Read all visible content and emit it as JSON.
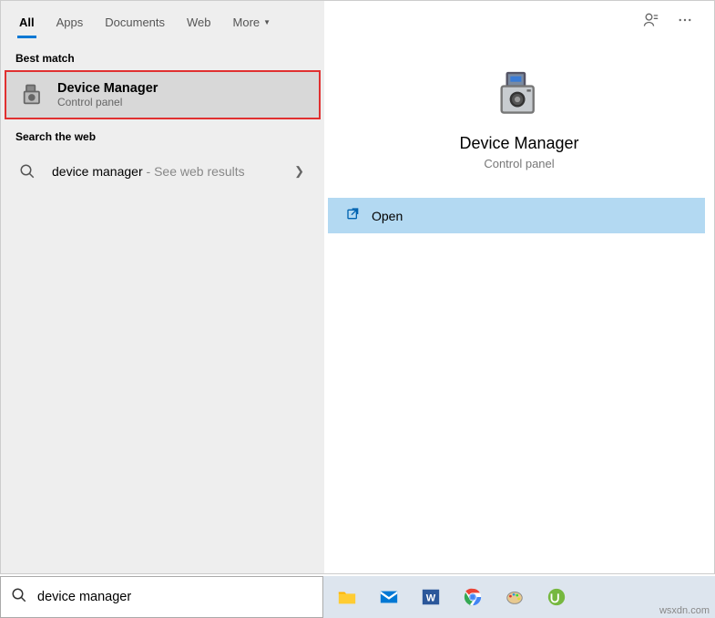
{
  "tabs": {
    "all": "All",
    "apps": "Apps",
    "documents": "Documents",
    "web": "Web",
    "more": "More"
  },
  "sections": {
    "best_match": "Best match",
    "search_web": "Search the web"
  },
  "result": {
    "title": "Device Manager",
    "subtitle": "Control panel"
  },
  "web_result": {
    "query": "device manager",
    "suffix": " - See web results"
  },
  "preview": {
    "title": "Device Manager",
    "subtitle": "Control panel"
  },
  "actions": {
    "open": "Open"
  },
  "search": {
    "value": "device manager"
  },
  "watermark": "wsxdn.com",
  "icons": {
    "device_manager": "device-manager-icon",
    "search": "search-icon",
    "chevron_right": "chevron-right-icon",
    "open": "open-icon",
    "feedback": "feedback-icon",
    "more": "more-icon"
  }
}
